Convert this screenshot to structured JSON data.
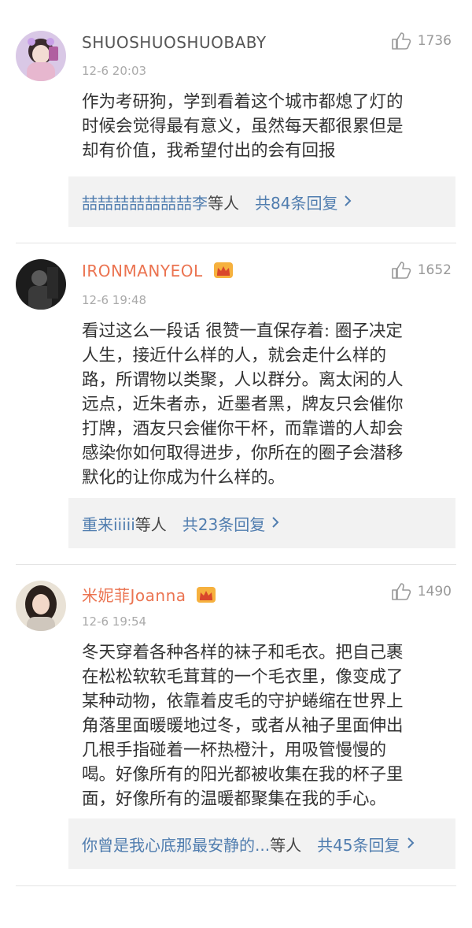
{
  "comments": [
    {
      "user": "SHUOSHUOSHUOBABY",
      "vip": false,
      "time": "12-6 20:03",
      "likes": "1736",
      "lines": [
        "作为考研狗，学到看着这个城市都熄了灯的",
        "时候会觉得最有意义，虽然每天都很累但是",
        "却有价值，我希望付出的会有回报"
      ],
      "reply_user": "喆喆喆喆喆喆喆李",
      "reply_etc": "等人",
      "reply_count": "共84条回复"
    },
    {
      "user": "IRONMANYEOL",
      "vip": true,
      "time": "12-6 19:48",
      "likes": "1652",
      "lines": [
        "看过这么一段话 很赞一直保存着: 圈子决定",
        "人生，接近什么样的人，就会走什么样的",
        "路，所谓物以类聚，人以群分。离太闲的人",
        "远点，近朱者赤，近墨者黑，牌友只会催你",
        "打牌，酒友只会催你干杯，而靠谱的人却会",
        "感染你如何取得进步，你所在的圈子会潜移",
        "默化的让你成为什么样的。"
      ],
      "reply_user": "重来iiiii",
      "reply_etc": "等人",
      "reply_count": "共23条回复"
    },
    {
      "user": "米妮菲Joanna",
      "vip": true,
      "time": "12-6 19:54",
      "likes": "1490",
      "lines": [
        "冬天穿着各种各样的袜子和毛衣。把自己裹",
        "在松松软软毛茸茸的一个毛衣里，像变成了",
        "某种动物，依靠着皮毛的守护蜷缩在世界上",
        "角落里面暖暖地过冬，或者从袖子里面伸出",
        "几根手指碰着一杯热橙汁，用吸管慢慢的",
        "喝。好像所有的阳光都被收集在我的杯子里",
        "面，好像所有的温暖都聚集在我的手心。"
      ],
      "reply_user": "你曾是我心底那最安静的...",
      "reply_etc": "等人",
      "reply_count": "共45条回复"
    }
  ],
  "icons": {
    "like": "thumbs-up-icon",
    "vip": "crown-icon",
    "more": "chevron-right-icon"
  },
  "colors": {
    "vip_name": "#eb7350",
    "link": "#507daf",
    "reply_bg": "#f2f2f2"
  }
}
